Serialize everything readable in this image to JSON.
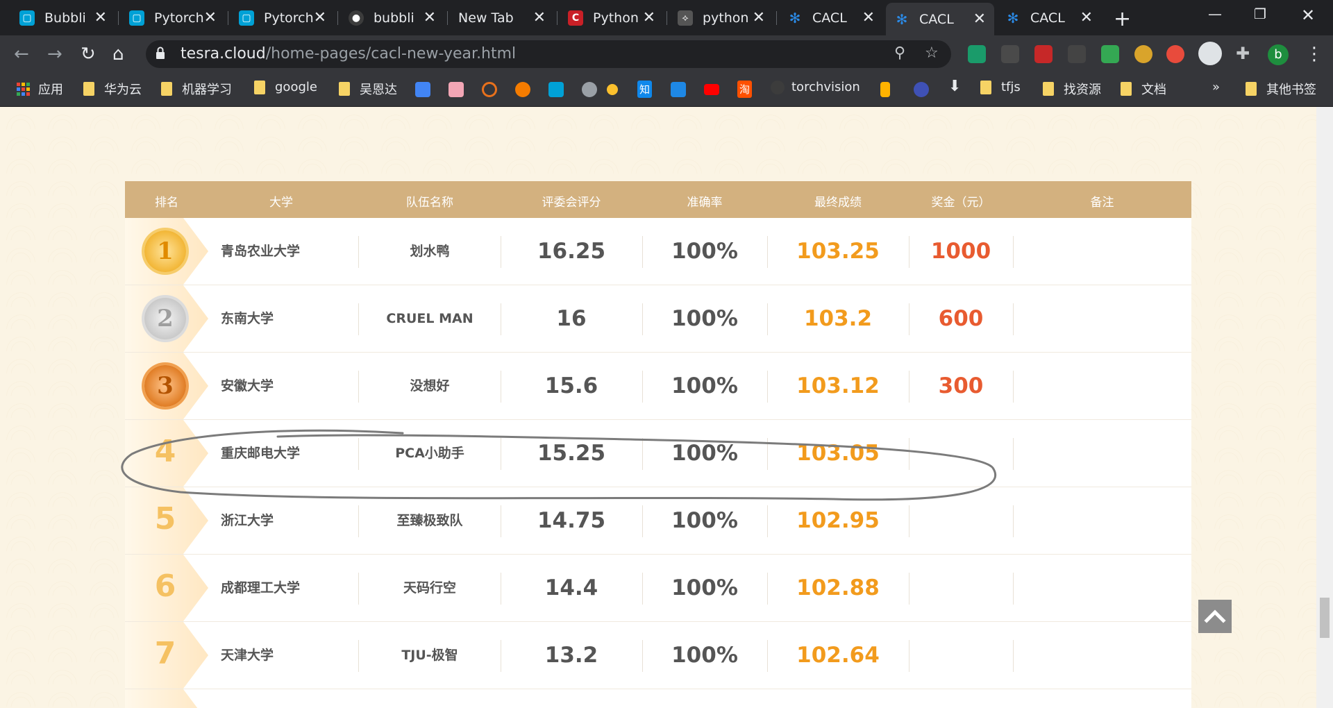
{
  "browser": {
    "tabs": [
      {
        "label": "Bubbli",
        "icon": "bilibili-icon",
        "color": "#00a1d6",
        "active": false
      },
      {
        "label": "Pytorch",
        "icon": "bilibili-icon",
        "color": "#00a1d6",
        "active": false
      },
      {
        "label": "Pytorch",
        "icon": "bilibili-icon",
        "color": "#00a1d6",
        "active": false
      },
      {
        "label": "bubbli",
        "icon": "github-icon",
        "color": "#24292e",
        "active": false
      },
      {
        "label": "New Tab",
        "icon": "",
        "color": "",
        "active": false
      },
      {
        "label": "Python",
        "icon": "csdn-icon",
        "color": "#c92027",
        "active": false
      },
      {
        "label": "python",
        "icon": "python-icon",
        "color": "#555555",
        "active": false
      },
      {
        "label": "CACL",
        "icon": "cacl-icon",
        "color": "#2b8ae6",
        "active": false
      },
      {
        "label": "CACL",
        "icon": "cacl-icon",
        "color": "#2b8ae6",
        "active": true
      },
      {
        "label": "CACL",
        "icon": "cacl-icon",
        "color": "#2b8ae6",
        "active": false
      }
    ],
    "url_host": "tesra.cloud",
    "url_path": "/home-pages/cacl-new-year.html",
    "profile_letter": "b",
    "bookmarks": {
      "apps": "应用",
      "huawei": "华为云",
      "ml": "机器学习",
      "google": "google",
      "wuenda": "吴恩达",
      "zhihu": "知",
      "taobao": "淘",
      "torchvision": "torchvision",
      "tfjs": "tfjs",
      "resources": "找资源",
      "docs": "文档",
      "overflow": "»",
      "other": "其他书签"
    }
  },
  "table": {
    "headers": [
      "排名",
      "大学",
      "队伍名称",
      "评委会评分",
      "准确率",
      "最终成绩",
      "奖金（元）",
      "备注"
    ],
    "rows": [
      {
        "rank": "1",
        "university": "青岛农业大学",
        "team": "划水鸭",
        "score": "16.25",
        "accuracy": "100%",
        "final": "103.25",
        "prize": "1000",
        "note": ""
      },
      {
        "rank": "2",
        "university": "东南大学",
        "team": "CRUEL MAN",
        "score": "16",
        "accuracy": "100%",
        "final": "103.2",
        "prize": "600",
        "note": ""
      },
      {
        "rank": "3",
        "university": "安徽大学",
        "team": "没想好",
        "score": "15.6",
        "accuracy": "100%",
        "final": "103.12",
        "prize": "300",
        "note": ""
      },
      {
        "rank": "4",
        "university": "重庆邮电大学",
        "team": "PCA小助手",
        "score": "15.25",
        "accuracy": "100%",
        "final": "103.05",
        "prize": "",
        "note": ""
      },
      {
        "rank": "5",
        "university": "浙江大学",
        "team": "至臻极致队",
        "score": "14.75",
        "accuracy": "100%",
        "final": "102.95",
        "prize": "",
        "note": ""
      },
      {
        "rank": "6",
        "university": "成都理工大学",
        "team": "天码行空",
        "score": "14.4",
        "accuracy": "100%",
        "final": "102.88",
        "prize": "",
        "note": ""
      },
      {
        "rank": "7",
        "university": "天津大学",
        "team": "TJU-极智",
        "score": "13.2",
        "accuracy": "100%",
        "final": "102.64",
        "prize": "",
        "note": ""
      }
    ]
  },
  "colors": {
    "header_bg": "#d3b17f",
    "final_score": "#f29b1d",
    "prize": "#e85b30",
    "gold": "#f2b636",
    "silver": "#c9c9c9",
    "bronze": "#e07d25"
  }
}
